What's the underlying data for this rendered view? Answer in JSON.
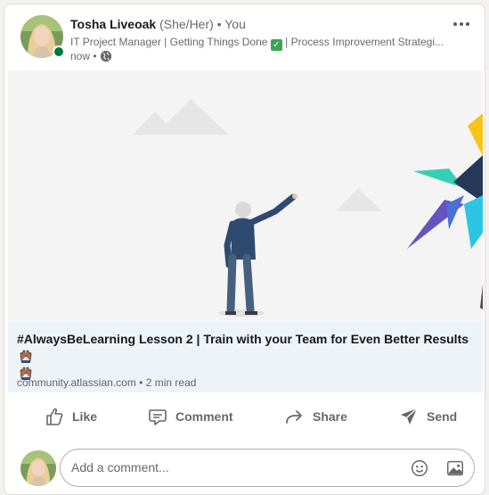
{
  "post": {
    "author_name": "Tosha Liveoak",
    "author_pronouns": "(She/Her)",
    "author_separator": "•",
    "author_you": "You",
    "headline_before_check": "IT Project Manager | Getting Things Done ",
    "headline_after_check": " | Process Improvement Strategi...",
    "check_emoji": "✓",
    "timestamp": "now •",
    "visibility_icon": "globe-icon",
    "more_icon": "more-horizontal-icon"
  },
  "article": {
    "title": "#AlwaysBeLearning Lesson 2 | Train with your Team for Even Better Results",
    "source": "community.atlassian.com",
    "separator": "•",
    "read_time": "2 min read",
    "emoji_icon": "raising-hands-icon"
  },
  "actions": {
    "like": "Like",
    "comment": "Comment",
    "share": "Share",
    "send": "Send"
  },
  "comment_bar": {
    "placeholder": "Add a comment...",
    "emoji_icon": "smiley-icon",
    "image_icon": "image-icon"
  },
  "colors": {
    "presence": "#057642",
    "link_preview_bg": "#eef3f8",
    "accent_yellow": "#f5c518",
    "accent_navy": "#253858",
    "accent_teal": "#36cfb4",
    "accent_cyan": "#2cc5e3",
    "accent_purple": "#6554c0"
  }
}
